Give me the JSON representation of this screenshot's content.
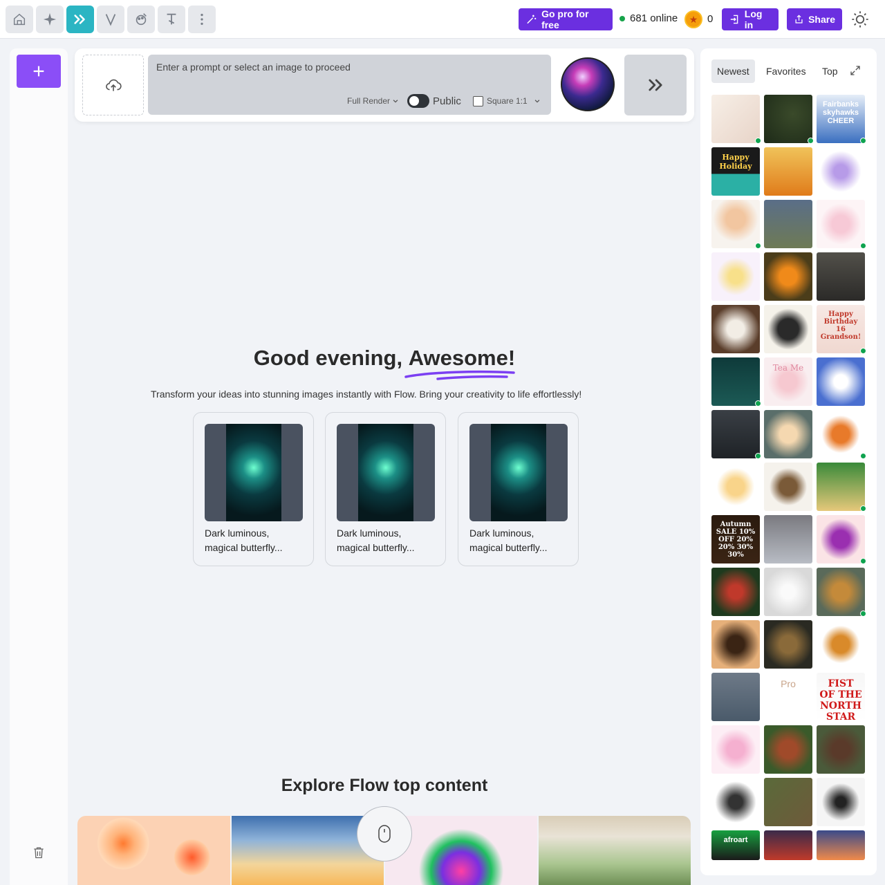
{
  "topbar": {
    "tools": [
      "home-icon",
      "sparkle-icon",
      "fast-forward-icon",
      "v-logo-icon",
      "palette-icon",
      "text-edit-icon",
      "more-vertical-icon"
    ],
    "go_pro_label": "Go pro for free",
    "online_text": "681 online",
    "coins": "0",
    "login_label": "Log in",
    "share_label": "Share"
  },
  "prompt": {
    "placeholder": "Enter a prompt or select an image to proceed",
    "render_mode": "Full Render",
    "public_label": "Public",
    "aspect_label": "Square 1:1"
  },
  "greeting": {
    "prefix": "Good evening, ",
    "name": "Awesome!",
    "subtitle": "Transform your ideas into stunning images instantly with Flow. Bring your creativity to life effortlessly!"
  },
  "suggestions": [
    {
      "caption_line1": "Dark luminous,",
      "caption_line2": "magical butterfly..."
    },
    {
      "caption_line1": "Dark luminous,",
      "caption_line2": "magical butterfly..."
    },
    {
      "caption_line1": "Dark luminous,",
      "caption_line2": "magical butterfly..."
    }
  ],
  "explore": {
    "title": "Explore Flow top content"
  },
  "gallery": {
    "tabs": [
      "Newest",
      "Favorites",
      "Top"
    ],
    "selected_tab": "Newest",
    "thumb_labels": {
      "fairbanks": "Fairbanks skyhawks CHEER",
      "holiday": "Happy Holiday",
      "birthday": "Happy Birthday 16 Grandson!",
      "tea": "Tea Me",
      "autumn": "Autumn SALE 10% OFF 20% 20% 30% 30%",
      "pro": "Pro",
      "fist": "FIST OF THE NORTH STAR",
      "afro": "afroart"
    }
  },
  "colors": {
    "accent": "#6b2fe0",
    "teal": "#2bb5c3",
    "online": "#16a34a"
  }
}
